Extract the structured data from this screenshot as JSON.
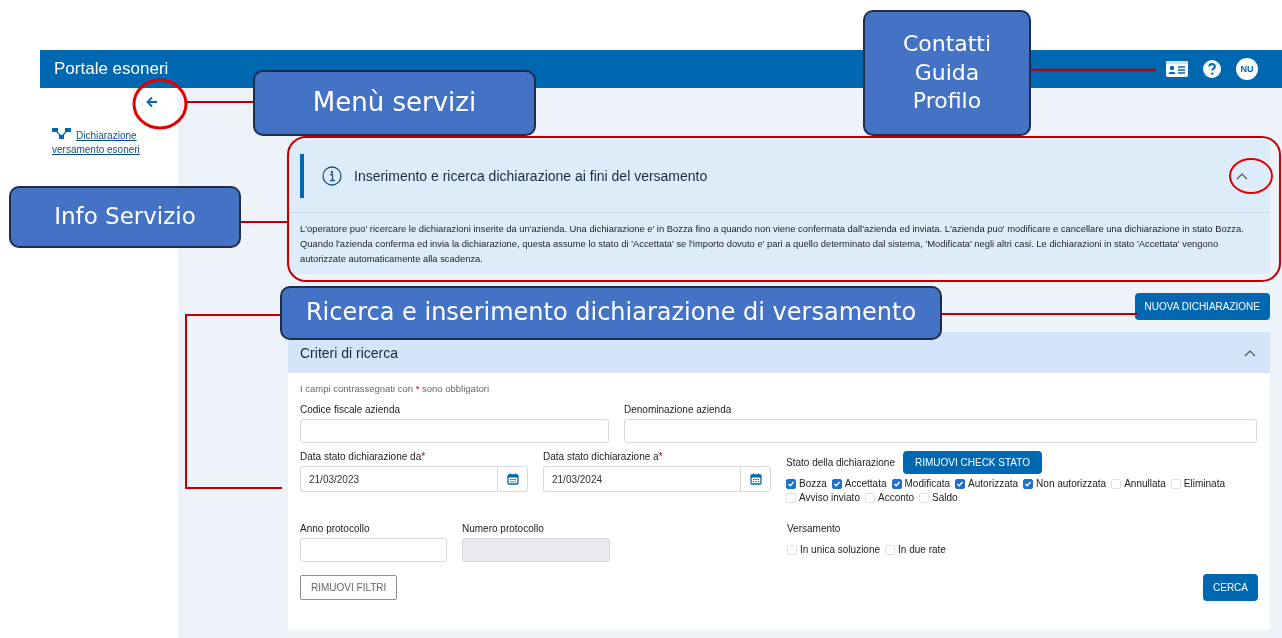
{
  "header": {
    "title": "Portale esoneri",
    "avatar": "NU"
  },
  "sidebar": {
    "items": [
      {
        "label": "Dichiarazione versamento esoneri"
      }
    ]
  },
  "info": {
    "title": "Inserimento e ricerca dichiarazione ai fini del versamento",
    "expanded": true,
    "text": "L'operatore puo' ricercare le dichiarazioni inserite da un'azienda. Una dichiarazione e' in Bozza fino a quando non viene confermata dall'azienda ed inviata. L'azienda puo' modificare e cancellare una dichiarazione in stato Bozza. Quando l'azienda conferma ed invia la dichiarazione, questa assume lo stato di 'Accettata' se l'importo dovuto e' pari a quello determinato dal sistema, 'Modificata' negli altri casi. Le dichiarazioni in stato 'Accettata' vengono autorizzate automaticamente alla scadenza."
  },
  "new_button": "NUOVA DICHIARAZIONE",
  "search": {
    "title": "Criteri di ricerca",
    "expanded": true,
    "note_before": "I campi contrassegnati con",
    "note_star": "*",
    "note_after": "sono obbligatori",
    "fields": [
      {
        "label": "Codice fiscale azienda",
        "kind": "text",
        "required": false
      },
      {
        "label": "Denominazione azienda",
        "kind": "text",
        "required": false
      },
      {
        "label": "Data stato dichiarazione da",
        "kind": "date",
        "required": true,
        "value": "21/03/2023"
      },
      {
        "label": "Data stato dichiarazione a",
        "kind": "date",
        "required": true,
        "value": "21/03/2024"
      },
      {
        "label": "Anno protocollo",
        "kind": "text",
        "required": false
      },
      {
        "label": "Numero protocollo",
        "kind": "disabled",
        "required": false
      }
    ],
    "status": {
      "label": "Stato della dichiarazione",
      "button": "RIMUOVI CHECK STATO",
      "options": [
        {
          "label": "Bozza",
          "checked": true
        },
        {
          "label": "Accettata",
          "checked": true
        },
        {
          "label": "Modificata",
          "checked": true
        },
        {
          "label": "Autorizzata",
          "checked": true
        },
        {
          "label": "Non autorizzata",
          "checked": true
        },
        {
          "label": "Annullata",
          "checked": false
        },
        {
          "label": "Eliminata",
          "checked": false
        },
        {
          "label": "Avviso inviato",
          "checked": false
        },
        {
          "label": "Acconto",
          "checked": false
        },
        {
          "label": "Saldo",
          "checked": false
        }
      ]
    },
    "payment": {
      "label": "Versamento",
      "options": [
        {
          "label": "In unica soluzione",
          "checked": false
        },
        {
          "label": "In due rate",
          "checked": false
        }
      ]
    },
    "clear_button": "RIMUOVI FILTRI",
    "search_button": "CERCA"
  },
  "callouts": [
    {
      "lines": [
        "Menù servizi"
      ]
    },
    {
      "lines": [
        "Info Servizio"
      ]
    },
    {
      "lines": [
        "Contatti",
        "Guida",
        "Profilo"
      ]
    },
    {
      "lines": [
        "Ricerca e inserimento dichiarazione di versamento"
      ]
    }
  ]
}
